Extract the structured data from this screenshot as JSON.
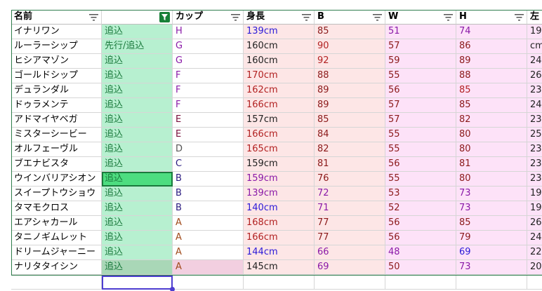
{
  "headers": [
    {
      "label": "名前",
      "filter": "filter-icon"
    },
    {
      "label": "",
      "filter": "filter-active-icon"
    },
    {
      "label": "カップ",
      "filter": "filter-icon"
    },
    {
      "label": "身長",
      "filter": "filter-icon"
    },
    {
      "label": "B",
      "filter": "filter-icon"
    },
    {
      "label": "W",
      "filter": "filter-icon"
    },
    {
      "label": "H",
      "filter": "filter-icon"
    },
    {
      "label": "左",
      "filter": ""
    }
  ],
  "rows": [
    {
      "name": "イナリワン",
      "status": "追込",
      "cup": "H",
      "height": "139cm",
      "b": "85",
      "w": "51",
      "h": "74",
      "extra": "19"
    },
    {
      "name": "ルーラーシップ",
      "status": "先行/追込",
      "cup": "G",
      "height": "160cm",
      "b": "90",
      "w": "57",
      "h": "86",
      "extra": "cm"
    },
    {
      "name": "ヒシアマゾン",
      "status": "追込",
      "cup": "G",
      "height": "160cm",
      "b": "92",
      "w": "59",
      "h": "89",
      "extra": "24"
    },
    {
      "name": "ゴールドシップ",
      "status": "追込",
      "cup": "F",
      "height": "170cm",
      "b": "88",
      "w": "55",
      "h": "88",
      "extra": "26"
    },
    {
      "name": "デュランダル",
      "status": "追込",
      "cup": "F",
      "height": "162cm",
      "b": "89",
      "w": "56",
      "h": "85",
      "extra": "23"
    },
    {
      "name": "ドゥラメンテ",
      "status": "追込",
      "cup": "F",
      "height": "166cm",
      "b": "89",
      "w": "57",
      "h": "85",
      "extra": "24"
    },
    {
      "name": "アドマイヤベガ",
      "status": "追込",
      "cup": "E",
      "height": "157cm",
      "b": "85",
      "w": "57",
      "h": "82",
      "extra": "23"
    },
    {
      "name": "ミスターシービー",
      "status": "追込",
      "cup": "E",
      "height": "166cm",
      "b": "84",
      "w": "55",
      "h": "80",
      "extra": "25"
    },
    {
      "name": "オルフェーヴル",
      "status": "追込",
      "cup": "D",
      "height": "165cm",
      "b": "82",
      "w": "55",
      "h": "80",
      "extra": "23"
    },
    {
      "name": "ブエナビスタ",
      "status": "追込",
      "cup": "C",
      "height": "159cm",
      "b": "81",
      "w": "56",
      "h": "81",
      "extra": "23"
    },
    {
      "name": "ウインバリアシオン",
      "status": "追込",
      "cup": "B",
      "height": "159cm",
      "b": "76",
      "w": "55",
      "h": "80",
      "extra": "23"
    },
    {
      "name": "スイープトウショウ",
      "status": "追込",
      "cup": "B",
      "height": "139cm",
      "b": "72",
      "w": "53",
      "h": "73",
      "extra": "19"
    },
    {
      "name": "タマモクロス",
      "status": "追込",
      "cup": "B",
      "height": "140cm",
      "b": "71",
      "w": "52",
      "h": "73",
      "extra": "19"
    },
    {
      "name": "エアシャカール",
      "status": "追込",
      "cup": "A",
      "height": "168cm",
      "b": "77",
      "w": "56",
      "h": "85",
      "extra": "26"
    },
    {
      "name": "タニノギムレット",
      "status": "追込",
      "cup": "A",
      "height": "166cm",
      "b": "77",
      "w": "56",
      "h": "79",
      "extra": "24"
    },
    {
      "name": "ドリームジャーニー",
      "status": "追込",
      "cup": "A",
      "height": "144cm",
      "b": "66",
      "w": "48",
      "h": "69",
      "extra": "22"
    },
    {
      "name": "ナリタタイシン",
      "status": "追込",
      "cup": "A",
      "height": "145cm",
      "b": "69",
      "w": "50",
      "h": "73",
      "extra": "20"
    }
  ],
  "colors": {
    "status_fill": "#b7f0d0",
    "selected_fill": "#4ddd80",
    "filter_active": "#188038",
    "selection_border": "#4d3dd0",
    "table_border": "#2f7d4d"
  }
}
